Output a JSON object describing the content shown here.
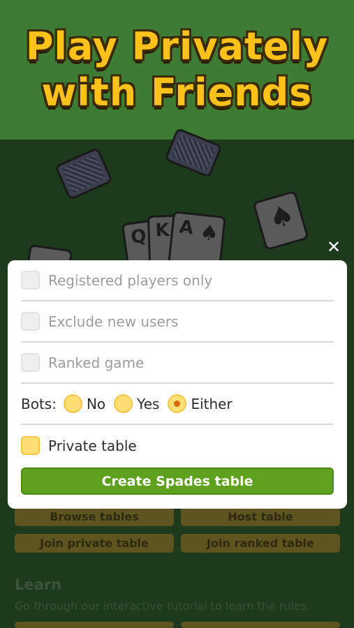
{
  "banner": {
    "line1": "Play Privately",
    "line2": "with Friends"
  },
  "scene": {
    "cards": [
      {
        "rank": "Q",
        "suit": "♠"
      },
      {
        "rank": "K",
        "suit": "♠"
      },
      {
        "rank": "A",
        "suit": "♠"
      },
      {
        "rank": "",
        "suit": "♠"
      }
    ],
    "buttons": {
      "browse": "Browse tables",
      "host": "Host table",
      "join_private": "Join private table",
      "join_ranked": "Join ranked table"
    },
    "learn": {
      "title": "Learn",
      "description": "Go through our interactive tutorial to learn the rules."
    }
  },
  "modal": {
    "close_icon": "✕",
    "options": {
      "registered_only": "Registered players only",
      "exclude_new": "Exclude new users",
      "ranked": "Ranked game",
      "private": "Private table"
    },
    "bots": {
      "label": "Bots:",
      "choices": [
        "No",
        "Yes",
        "Either"
      ],
      "selected": "Either"
    },
    "create_button": "Create Spades table"
  },
  "colors": {
    "banner_bg": "#3c7c34",
    "title_yellow": "#ffc21a",
    "create_green": "#5ea11e",
    "toggle_yellow": "#ffdf73"
  }
}
